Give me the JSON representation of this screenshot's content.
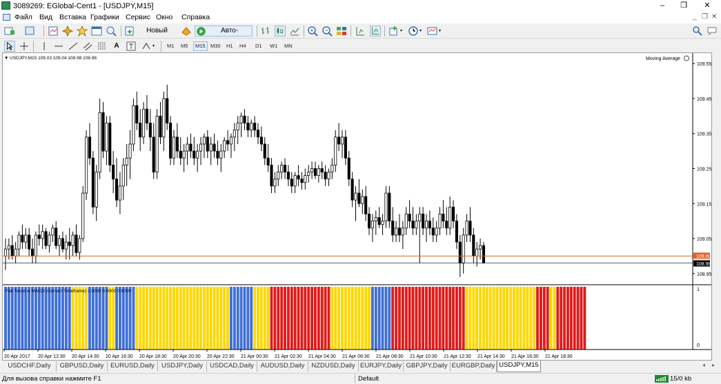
{
  "window": {
    "title": "3089269: EGlobal-Cent1 - [USDJPY,M15]",
    "minimize": "–",
    "restore": "❐",
    "close": "✕"
  },
  "menu": {
    "items": [
      "Файл",
      "Вид",
      "Вставка",
      "Графики",
      "Сервис",
      "Окно",
      "Справка"
    ],
    "mdi_minimize": "_",
    "mdi_restore": "❐",
    "mdi_close": "✕"
  },
  "toolbar": {
    "new_order": "Новый ордер",
    "auto_trading": "Авто-торговля",
    "text_tool": "A"
  },
  "timeframes": [
    "M1",
    "M5",
    "M15",
    "M30",
    "H1",
    "H4",
    "D1",
    "W1",
    "MN"
  ],
  "active_timeframe": "M15",
  "chart": {
    "header": "USDJPY,M15  109.03 109.04 108.98 108.98",
    "indicator_label": "Moving Average",
    "price_ticks": [
      "109.55",
      "109.45",
      "109.35",
      "109.25",
      "109.15",
      "109.05",
      "108.95"
    ],
    "ask_label": "109.00",
    "bid_label": "108.98",
    "subwindow_label": "Flat Trend w MACD (Current Timeframe) 1.0000 0.0000 0.0000",
    "subwindow_ticks": [
      "1",
      "0"
    ],
    "time_labels": [
      "20 Apr 2017",
      "20 Apr 12:30",
      "20 Apr 14:30",
      "20 Apr 16:30",
      "20 Apr 18:30",
      "20 Apr 20:30",
      "20 Apr 22:30",
      "21 Apr 00:30",
      "21 Apr 02:30",
      "21 Apr 04:30",
      "21 Apr 06:30",
      "21 Apr 08:30",
      "21 Apr 10:30",
      "21 Apr 12:30",
      "21 Apr 14:30",
      "21 Apr 16:30",
      "21 Apr 18:30"
    ],
    "colors": {
      "bull": "#ffffff",
      "bear": "#000000",
      "ask_line": "#e0622b",
      "bid_line": "#000000",
      "flat_blue": "#3f6fd6",
      "flat_yellow": "#ffd700",
      "flat_red": "#e01b1b"
    }
  },
  "chart_data": {
    "type": "candlestick",
    "symbol": "USDJPY",
    "timeframe": "M15",
    "ylim": [
      108.92,
      109.58
    ],
    "candles": [
      [
        109.0,
        109.05,
        108.96,
        109.02
      ],
      [
        109.02,
        109.05,
        108.99,
        109.03
      ],
      [
        109.03,
        109.06,
        108.99,
        109.0
      ],
      [
        109.0,
        109.04,
        108.98,
        109.02
      ],
      [
        109.02,
        109.07,
        109.0,
        109.06
      ],
      [
        109.06,
        109.09,
        109.02,
        109.04
      ],
      [
        109.04,
        109.08,
        109.02,
        109.06
      ],
      [
        109.06,
        109.08,
        109.0,
        109.02
      ],
      [
        109.02,
        109.05,
        108.98,
        109.0
      ],
      [
        109.0,
        109.07,
        108.98,
        109.06
      ],
      [
        109.06,
        109.09,
        109.03,
        109.05
      ],
      [
        109.05,
        109.09,
        109.02,
        109.07
      ],
      [
        109.07,
        109.08,
        109.02,
        109.03
      ],
      [
        109.03,
        109.07,
        109.01,
        109.06
      ],
      [
        109.06,
        109.09,
        109.04,
        109.08
      ],
      [
        109.08,
        109.1,
        109.02,
        109.03
      ],
      [
        109.03,
        109.06,
        109.0,
        109.05
      ],
      [
        109.05,
        109.07,
        109.01,
        109.02
      ],
      [
        109.02,
        109.06,
        108.99,
        109.04
      ],
      [
        109.04,
        109.08,
        108.99,
        109.03
      ],
      [
        109.03,
        109.07,
        109.0,
        109.06
      ],
      [
        109.06,
        109.09,
        109.0,
        109.01
      ],
      [
        109.01,
        109.06,
        108.99,
        109.05
      ],
      [
        109.05,
        109.2,
        109.04,
        109.18
      ],
      [
        109.18,
        109.36,
        109.16,
        109.34
      ],
      [
        109.34,
        109.38,
        109.26,
        109.28
      ],
      [
        109.28,
        109.3,
        109.12,
        109.14
      ],
      [
        109.14,
        109.26,
        109.1,
        109.24
      ],
      [
        109.24,
        109.45,
        109.22,
        109.41
      ],
      [
        109.41,
        109.44,
        109.28,
        109.3
      ],
      [
        109.3,
        109.4,
        109.26,
        109.38
      ],
      [
        109.38,
        109.4,
        109.24,
        109.26
      ],
      [
        109.26,
        109.3,
        109.18,
        109.22
      ],
      [
        109.22,
        109.28,
        109.14,
        109.16
      ],
      [
        109.16,
        109.24,
        109.12,
        109.2
      ],
      [
        109.2,
        109.28,
        109.16,
        109.26
      ],
      [
        109.26,
        109.32,
        109.2,
        109.28
      ],
      [
        109.28,
        109.36,
        109.22,
        109.32
      ],
      [
        109.32,
        109.45,
        109.3,
        109.43
      ],
      [
        109.43,
        109.47,
        109.36,
        109.38
      ],
      [
        109.38,
        109.42,
        109.3,
        109.34
      ],
      [
        109.34,
        109.44,
        109.32,
        109.42
      ],
      [
        109.42,
        109.46,
        109.36,
        109.38
      ],
      [
        109.38,
        109.42,
        109.3,
        109.34
      ],
      [
        109.34,
        109.38,
        109.22,
        109.24
      ],
      [
        109.24,
        109.42,
        109.22,
        109.4
      ],
      [
        109.4,
        109.44,
        109.32,
        109.34
      ],
      [
        109.34,
        109.47,
        109.3,
        109.45
      ],
      [
        109.45,
        109.49,
        109.36,
        109.38
      ],
      [
        109.38,
        109.4,
        109.26,
        109.28
      ],
      [
        109.28,
        109.36,
        109.26,
        109.34
      ],
      [
        109.34,
        109.38,
        109.28,
        109.3
      ],
      [
        109.3,
        109.34,
        109.26,
        109.28
      ],
      [
        109.28,
        109.32,
        109.24,
        109.3
      ],
      [
        109.3,
        109.34,
        109.26,
        109.32
      ],
      [
        109.32,
        109.35,
        109.28,
        109.3
      ],
      [
        109.3,
        109.34,
        109.26,
        109.28
      ],
      [
        109.28,
        109.32,
        109.24,
        109.3
      ],
      [
        109.3,
        109.34,
        109.26,
        109.32
      ],
      [
        109.32,
        109.35,
        109.28,
        109.34
      ],
      [
        109.34,
        109.36,
        109.28,
        109.3
      ],
      [
        109.3,
        109.34,
        109.26,
        109.32
      ],
      [
        109.32,
        109.35,
        109.28,
        109.3
      ],
      [
        109.3,
        109.33,
        109.26,
        109.28
      ],
      [
        109.28,
        109.32,
        109.24,
        109.3
      ],
      [
        109.3,
        109.34,
        109.28,
        109.33
      ],
      [
        109.33,
        109.36,
        109.3,
        109.32
      ],
      [
        109.32,
        109.35,
        109.28,
        109.34
      ],
      [
        109.34,
        109.38,
        109.3,
        109.36
      ],
      [
        109.36,
        109.4,
        109.32,
        109.38
      ],
      [
        109.38,
        109.41,
        109.34,
        109.4
      ],
      [
        109.4,
        109.42,
        109.36,
        109.38
      ],
      [
        109.38,
        109.4,
        109.34,
        109.36
      ],
      [
        109.36,
        109.39,
        109.34,
        109.38
      ],
      [
        109.38,
        109.4,
        109.34,
        109.36
      ],
      [
        109.36,
        109.38,
        109.32,
        109.34
      ],
      [
        109.34,
        109.37,
        109.3,
        109.32
      ],
      [
        109.32,
        109.34,
        109.26,
        109.28
      ],
      [
        109.28,
        109.32,
        109.24,
        109.26
      ],
      [
        109.26,
        109.28,
        109.18,
        109.2
      ],
      [
        109.2,
        109.24,
        109.18,
        109.22
      ],
      [
        109.22,
        109.26,
        109.2,
        109.24
      ],
      [
        109.24,
        109.27,
        109.22,
        109.26
      ],
      [
        109.26,
        109.28,
        109.22,
        109.24
      ],
      [
        109.24,
        109.26,
        109.2,
        109.22
      ],
      [
        109.22,
        109.24,
        109.18,
        109.2
      ],
      [
        109.2,
        109.24,
        109.18,
        109.23
      ],
      [
        109.23,
        109.26,
        109.2,
        109.22
      ],
      [
        109.22,
        109.24,
        109.19,
        109.21
      ],
      [
        109.21,
        109.25,
        109.19,
        109.23
      ],
      [
        109.23,
        109.26,
        109.21,
        109.24
      ],
      [
        109.24,
        109.27,
        109.22,
        109.25
      ],
      [
        109.25,
        109.27,
        109.22,
        109.23
      ],
      [
        109.23,
        109.26,
        109.21,
        109.25
      ],
      [
        109.25,
        109.27,
        109.22,
        109.24
      ],
      [
        109.24,
        109.26,
        109.2,
        109.22
      ],
      [
        109.22,
        109.25,
        109.2,
        109.24
      ],
      [
        109.24,
        109.28,
        109.22,
        109.26
      ],
      [
        109.26,
        109.36,
        109.24,
        109.34
      ],
      [
        109.34,
        109.38,
        109.3,
        109.32
      ],
      [
        109.32,
        109.36,
        109.28,
        109.34
      ],
      [
        109.34,
        109.36,
        109.26,
        109.28
      ],
      [
        109.28,
        109.3,
        109.2,
        109.22
      ],
      [
        109.22,
        109.24,
        109.14,
        109.16
      ],
      [
        109.16,
        109.2,
        109.1,
        109.18
      ],
      [
        109.18,
        109.22,
        109.14,
        109.15
      ],
      [
        109.15,
        109.19,
        109.12,
        109.17
      ],
      [
        109.17,
        109.2,
        109.1,
        109.12
      ],
      [
        109.12,
        109.14,
        109.06,
        109.08
      ],
      [
        109.08,
        109.12,
        109.04,
        109.1
      ],
      [
        109.1,
        109.13,
        109.06,
        109.11
      ],
      [
        109.11,
        109.14,
        109.08,
        109.09
      ],
      [
        109.09,
        109.12,
        109.06,
        109.1
      ],
      [
        109.1,
        109.2,
        109.08,
        109.18
      ],
      [
        109.18,
        109.2,
        109.08,
        109.1
      ],
      [
        109.1,
        109.14,
        109.04,
        109.06
      ],
      [
        109.06,
        109.1,
        109.04,
        109.08
      ],
      [
        109.08,
        109.12,
        109.04,
        109.06
      ],
      [
        109.06,
        109.1,
        109.02,
        109.08
      ],
      [
        109.08,
        109.14,
        109.06,
        109.12
      ],
      [
        109.12,
        109.16,
        109.08,
        109.1
      ],
      [
        109.1,
        109.14,
        109.06,
        109.08
      ],
      [
        109.08,
        109.12,
        109.06,
        109.1
      ],
      [
        109.1,
        109.14,
        108.98,
        109.12
      ],
      [
        109.12,
        109.14,
        109.06,
        109.08
      ],
      [
        109.08,
        109.12,
        109.04,
        109.1
      ],
      [
        109.1,
        109.13,
        109.06,
        109.08
      ],
      [
        109.08,
        109.11,
        109.04,
        109.06
      ],
      [
        109.06,
        109.1,
        109.04,
        109.08
      ],
      [
        109.08,
        109.14,
        109.06,
        109.12
      ],
      [
        109.12,
        109.16,
        109.08,
        109.1
      ],
      [
        109.1,
        109.14,
        109.06,
        109.08
      ],
      [
        109.08,
        109.17,
        109.06,
        109.14
      ],
      [
        109.14,
        109.16,
        109.08,
        109.1
      ],
      [
        109.1,
        109.12,
        109.02,
        109.04
      ],
      [
        109.04,
        109.06,
        108.94,
        108.98
      ],
      [
        108.98,
        109.08,
        108.95,
        109.06
      ],
      [
        109.06,
        109.12,
        109.04,
        109.1
      ],
      [
        109.1,
        109.14,
        109.04,
        109.06
      ],
      [
        109.06,
        109.08,
        108.98,
        109.0
      ],
      [
        109.0,
        109.04,
        108.97,
        109.02
      ],
      [
        109.02,
        109.05,
        108.99,
        109.03
      ],
      [
        109.03,
        109.04,
        108.98,
        108.98
      ]
    ],
    "flat_trend_colors": [
      "blue",
      "blue",
      "blue",
      "blue",
      "blue",
      "blue",
      "blue",
      "blue",
      "blue",
      "blue",
      "blue",
      "blue",
      "blue",
      "blue",
      "blue",
      "blue",
      "blue",
      "blue",
      "blue",
      "blue",
      "yellow",
      "yellow",
      "yellow",
      "yellow",
      "yellow",
      "blue",
      "blue",
      "blue",
      "blue",
      "blue",
      "blue",
      "yellow",
      "yellow",
      "blue",
      "blue",
      "blue",
      "blue",
      "blue",
      "blue",
      "yellow",
      "yellow",
      "yellow",
      "yellow",
      "yellow",
      "yellow",
      "yellow",
      "yellow",
      "yellow",
      "yellow",
      "yellow",
      "yellow",
      "yellow",
      "yellow",
      "yellow",
      "yellow",
      "yellow",
      "yellow",
      "yellow",
      "yellow",
      "yellow",
      "yellow",
      "yellow",
      "yellow",
      "yellow",
      "yellow",
      "yellow",
      "yellow",
      "blue",
      "blue",
      "blue",
      "blue",
      "blue",
      "blue",
      "blue",
      "yellow",
      "yellow",
      "yellow",
      "yellow",
      "yellow",
      "red",
      "red",
      "red",
      "red",
      "red",
      "red",
      "red",
      "red",
      "red",
      "red",
      "red",
      "red",
      "red",
      "red",
      "red",
      "red",
      "red",
      "red",
      "yellow",
      "yellow",
      "yellow",
      "yellow",
      "yellow",
      "yellow",
      "yellow",
      "yellow",
      "yellow",
      "yellow",
      "yellow",
      "yellow",
      "blue",
      "blue",
      "blue",
      "blue",
      "blue",
      "blue",
      "red",
      "red",
      "red",
      "red",
      "red",
      "red",
      "red",
      "red",
      "red",
      "red",
      "red",
      "red",
      "red",
      "red",
      "red",
      "red",
      "red",
      "red",
      "red",
      "red",
      "red",
      "red",
      "yellow",
      "yellow",
      "yellow",
      "yellow",
      "yellow",
      "yellow",
      "yellow",
      "yellow",
      "yellow",
      "yellow",
      "yellow",
      "yellow",
      "yellow",
      "yellow",
      "yellow",
      "yellow",
      "yellow",
      "yellow",
      "yellow",
      "yellow",
      "yellow",
      "red",
      "red",
      "red",
      "red",
      "yellow",
      "yellow",
      "red",
      "red",
      "red",
      "red",
      "red",
      "red",
      "red",
      "red",
      "red"
    ],
    "subwindow_ylim": [
      0,
      1
    ]
  },
  "tabs": [
    "USDCHF,Daily",
    "GBPUSD,Daily",
    "EURUSD,Daily",
    "USDJPY,Daily",
    "USDCAD,Daily",
    "AUDUSD,Daily",
    "NZDUSD,Daily",
    "EURJPY,Daily",
    "GBPJPY,Daily",
    "EURGBP,Daily",
    "USDJPY,M15"
  ],
  "active_tab": "USDJPY,M15",
  "status": {
    "help": "Для вызова справки нажмите F1",
    "profile": "Default",
    "traffic": "15/0 kb"
  }
}
